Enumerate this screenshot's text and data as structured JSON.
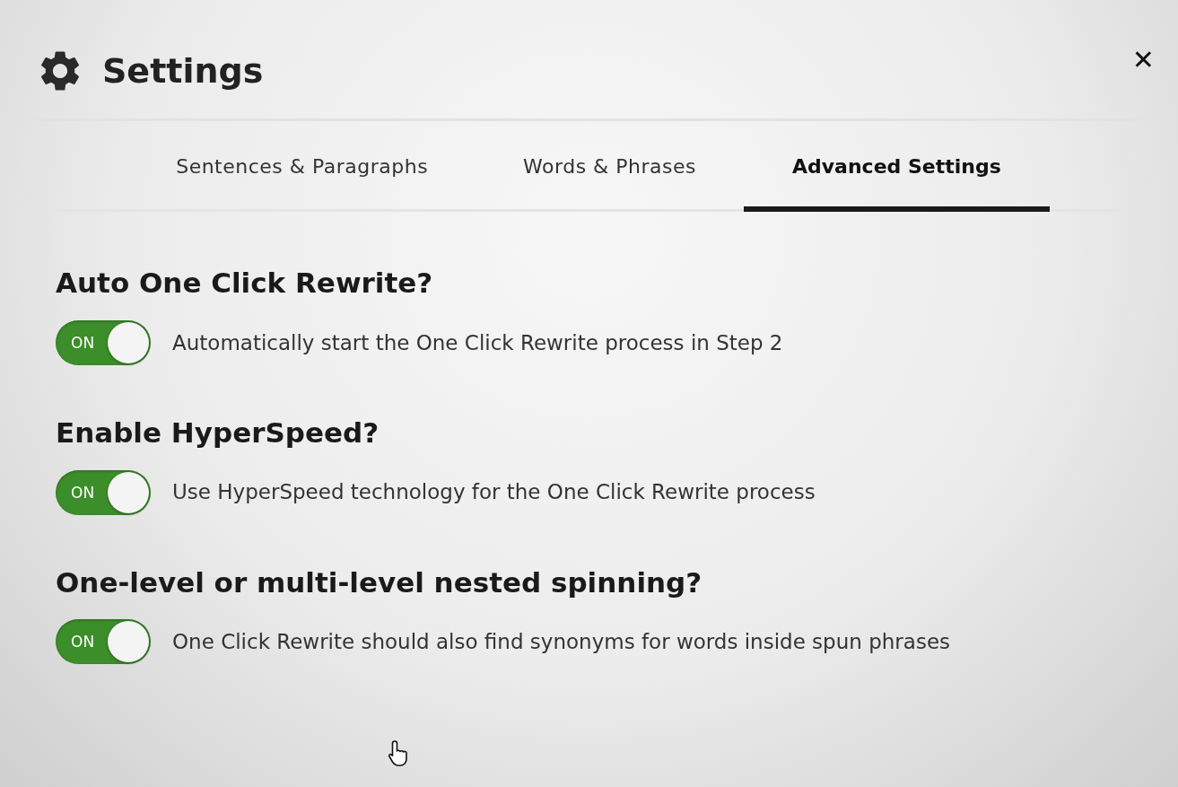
{
  "dialog": {
    "title": "Settings",
    "close": "✕"
  },
  "tabs": [
    {
      "label": "Sentences & Paragraphs",
      "selected": false
    },
    {
      "label": "Words & Phrases",
      "selected": false
    },
    {
      "label": "Advanced Settings",
      "selected": true
    }
  ],
  "settings": [
    {
      "heading": "Auto One Click Rewrite?",
      "toggle_label": "ON",
      "on": true,
      "description": "Automatically start the One Click Rewrite process in Step 2"
    },
    {
      "heading": "Enable HyperSpeed?",
      "toggle_label": "ON",
      "on": true,
      "description": "Use HyperSpeed technology for the One Click Rewrite process"
    },
    {
      "heading": "One-level or multi-level nested spinning?",
      "toggle_label": "ON",
      "on": true,
      "description": "One Click Rewrite should also find synonyms for words inside spun phrases"
    }
  ]
}
